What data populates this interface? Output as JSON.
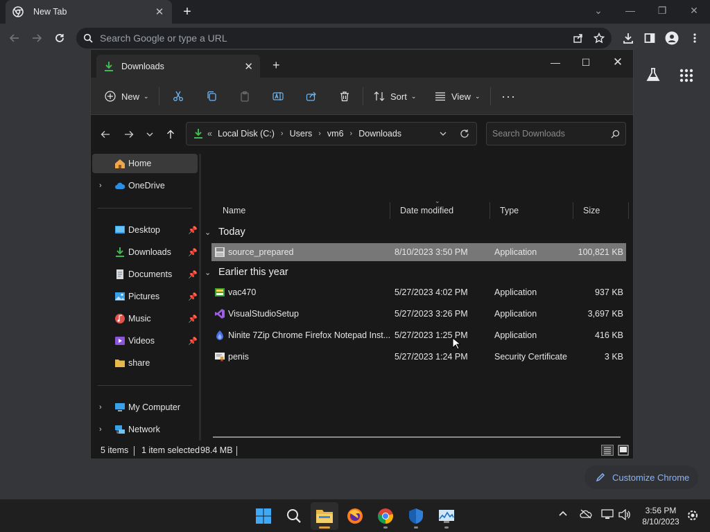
{
  "browser": {
    "tab_title": "New Tab",
    "omnibox_placeholder": "Search Google or type a URL",
    "customize_label": "Customize Chrome"
  },
  "explorer": {
    "tab_title": "Downloads",
    "commands": {
      "new_label": "New",
      "sort_label": "Sort",
      "view_label": "View"
    },
    "breadcrumb": [
      "Local Disk (C:)",
      "Users",
      "vm6",
      "Downloads"
    ],
    "search_placeholder": "Search Downloads",
    "nav": {
      "home": "Home",
      "onedrive": "OneDrive",
      "desktop": "Desktop",
      "downloads": "Downloads",
      "documents": "Documents",
      "pictures": "Pictures",
      "music": "Music",
      "videos": "Videos",
      "share": "share",
      "my_computer": "My Computer",
      "network": "Network"
    },
    "columns": [
      "Name",
      "Date modified",
      "Type",
      "Size"
    ],
    "groups": {
      "today": "Today",
      "earlier": "Earlier this year"
    },
    "files": [
      {
        "name": "source_prepared",
        "date": "8/10/2023 3:50 PM",
        "type": "Application",
        "size": "100,821 KB",
        "selected": true
      },
      {
        "name": "vac470",
        "date": "5/27/2023 4:02 PM",
        "type": "Application",
        "size": "937 KB"
      },
      {
        "name": "VisualStudioSetup",
        "date": "5/27/2023 3:26 PM",
        "type": "Application",
        "size": "3,697 KB"
      },
      {
        "name": "Ninite 7Zip Chrome Firefox Notepad Inst...",
        "date": "5/27/2023 1:25 PM",
        "type": "Application",
        "size": "416 KB"
      },
      {
        "name": "penis",
        "date": "5/27/2023 1:24 PM",
        "type": "Security Certificate",
        "size": "3 KB"
      }
    ],
    "status": {
      "items": "5 items",
      "selected": "1 item selected",
      "size": "98.4 MB"
    }
  },
  "taskbar": {
    "time": "3:56 PM",
    "date": "8/10/2023"
  },
  "colors": {
    "accent": "#8ab4f8",
    "selection": "#777777",
    "folder": "#e8b84a",
    "downloads_green": "#3fb950"
  }
}
